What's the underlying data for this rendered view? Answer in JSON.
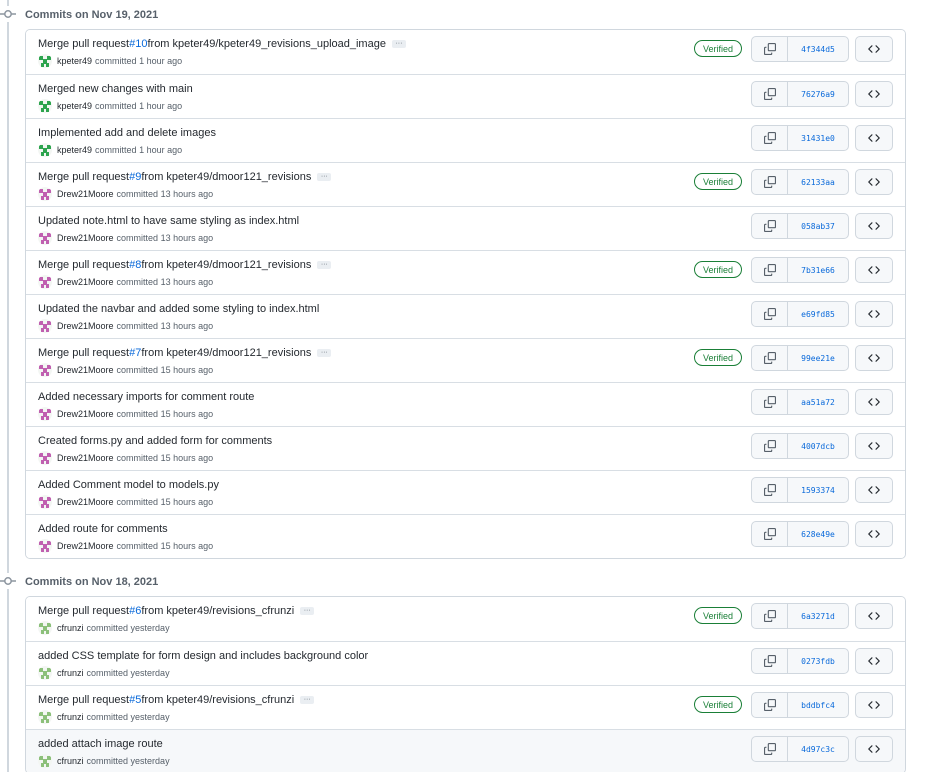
{
  "groups": [
    {
      "title": "Commits on Nov 19, 2021",
      "commits": [
        {
          "prefix": "Merge pull request ",
          "pr": "#10",
          "suffix": " from kpeter49/kpeter49_revisions_upload_image",
          "has_more": true,
          "author": "kpeter49",
          "avatar": "kpeter49",
          "action": "committed",
          "time": "1 hour ago",
          "verified": "Verified",
          "sha": "4f344d5"
        },
        {
          "prefix": "Merged new changes with main",
          "pr": "",
          "suffix": "",
          "has_more": false,
          "author": "kpeter49",
          "avatar": "kpeter49",
          "action": "committed",
          "time": "1 hour ago",
          "verified": "",
          "sha": "76276a9"
        },
        {
          "prefix": "Implemented add and delete images",
          "pr": "",
          "suffix": "",
          "has_more": false,
          "author": "kpeter49",
          "avatar": "kpeter49",
          "action": "committed",
          "time": "1 hour ago",
          "verified": "",
          "sha": "31431e0"
        },
        {
          "prefix": "Merge pull request ",
          "pr": "#9",
          "suffix": " from kpeter49/dmoor121_revisions",
          "has_more": true,
          "author": "Drew21Moore",
          "avatar": "drew",
          "action": "committed",
          "time": "13 hours ago",
          "verified": "Verified",
          "sha": "62133aa"
        },
        {
          "prefix": "Updated note.html to have same styling as index.html",
          "pr": "",
          "suffix": "",
          "has_more": false,
          "author": "Drew21Moore",
          "avatar": "drew",
          "action": "committed",
          "time": "13 hours ago",
          "verified": "",
          "sha": "058ab37"
        },
        {
          "prefix": "Merge pull request ",
          "pr": "#8",
          "suffix": " from kpeter49/dmoor121_revisions",
          "has_more": true,
          "author": "Drew21Moore",
          "avatar": "drew",
          "action": "committed",
          "time": "13 hours ago",
          "verified": "Verified",
          "sha": "7b31e66"
        },
        {
          "prefix": "Updated the navbar and added some styling to index.html",
          "pr": "",
          "suffix": "",
          "has_more": false,
          "author": "Drew21Moore",
          "avatar": "drew",
          "action": "committed",
          "time": "13 hours ago",
          "verified": "",
          "sha": "e69fd85"
        },
        {
          "prefix": "Merge pull request ",
          "pr": "#7",
          "suffix": " from kpeter49/dmoor121_revisions",
          "has_more": true,
          "author": "Drew21Moore",
          "avatar": "drew",
          "action": "committed",
          "time": "15 hours ago",
          "verified": "Verified",
          "sha": "99ee21e"
        },
        {
          "prefix": "Added necessary imports for comment route",
          "pr": "",
          "suffix": "",
          "has_more": false,
          "author": "Drew21Moore",
          "avatar": "drew",
          "action": "committed",
          "time": "15 hours ago",
          "verified": "",
          "sha": "aa51a72"
        },
        {
          "prefix": "Created forms.py and added form for comments",
          "pr": "",
          "suffix": "",
          "has_more": false,
          "author": "Drew21Moore",
          "avatar": "drew",
          "action": "committed",
          "time": "15 hours ago",
          "verified": "",
          "sha": "4007dcb"
        },
        {
          "prefix": "Added Comment model to models.py",
          "pr": "",
          "suffix": "",
          "has_more": false,
          "author": "Drew21Moore",
          "avatar": "drew",
          "action": "committed",
          "time": "15 hours ago",
          "verified": "",
          "sha": "1593374"
        },
        {
          "prefix": "Added route for comments",
          "pr": "",
          "suffix": "",
          "has_more": false,
          "author": "Drew21Moore",
          "avatar": "drew",
          "action": "committed",
          "time": "15 hours ago",
          "verified": "",
          "sha": "628e49e"
        }
      ]
    },
    {
      "title": "Commits on Nov 18, 2021",
      "commits": [
        {
          "prefix": "Merge pull request ",
          "pr": "#6",
          "suffix": " from kpeter49/revisions_cfrunzi",
          "has_more": true,
          "author": "cfrunzi",
          "avatar": "cfrunzi",
          "action": "committed",
          "time": "yesterday",
          "verified": "Verified",
          "sha": "6a3271d"
        },
        {
          "prefix": "added CSS template for form design and includes background color",
          "pr": "",
          "suffix": "",
          "has_more": false,
          "author": "cfrunzi",
          "avatar": "cfrunzi",
          "action": "committed",
          "time": "yesterday",
          "verified": "",
          "sha": "0273fdb"
        },
        {
          "prefix": "Merge pull request ",
          "pr": "#5",
          "suffix": " from kpeter49/revisions_cfrunzi",
          "has_more": true,
          "author": "cfrunzi",
          "avatar": "cfrunzi",
          "action": "committed",
          "time": "yesterday",
          "verified": "Verified",
          "sha": "bddbfc4"
        },
        {
          "prefix": "added attach image route",
          "pr": "",
          "suffix": "",
          "has_more": false,
          "author": "cfrunzi",
          "avatar": "cfrunzi",
          "action": "committed",
          "time": "yesterday",
          "verified": "",
          "sha": "4d97c3c",
          "highlight": true
        }
      ]
    }
  ],
  "ellipsis_label": "···",
  "avatar_colors": {
    "kpeter49": "#2da44e",
    "drew": "#c060b0",
    "cfrunzi": "#8cc07a"
  },
  "icons": {
    "copy": "copy-icon",
    "browse": "code-icon",
    "commit": "git-commit-icon",
    "more": "ellipsis-icon"
  }
}
